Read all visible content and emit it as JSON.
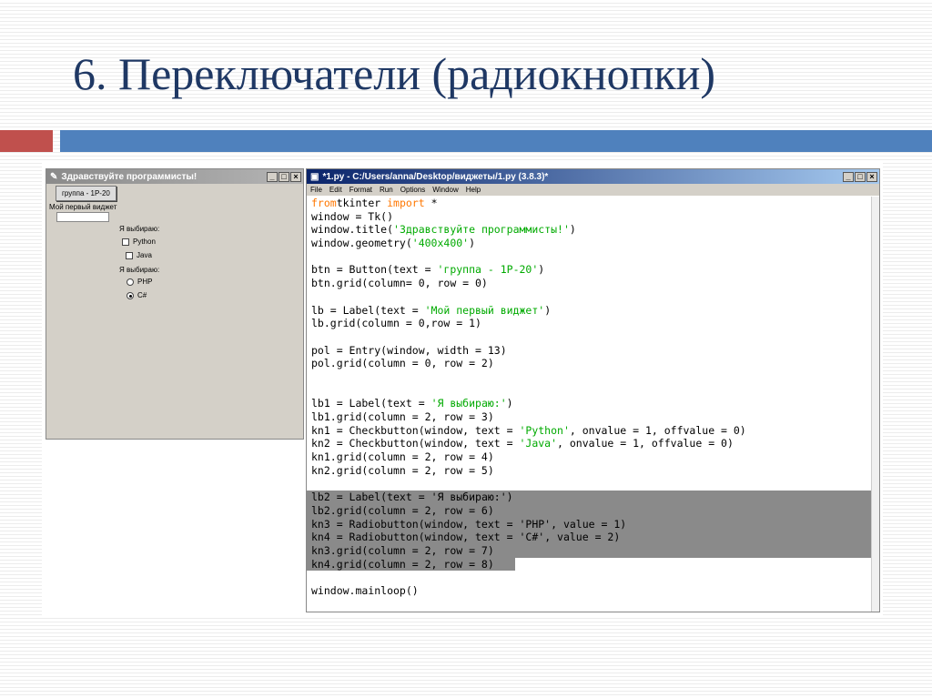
{
  "slide": {
    "title": "6. Переключатели (радиокнопки)"
  },
  "tk_window": {
    "title": "Здравствуйте программисты!",
    "button": "группа - 1Р-20",
    "label": "Мой первый виджет",
    "entry_value": "",
    "label1": "Я выбираю:",
    "check1": "Python",
    "check2": "Java",
    "label2": "Я выбираю:",
    "radio1": "PHP",
    "radio2": "C#",
    "selected_radio": "C#"
  },
  "idle": {
    "title": "*1.py - C:/Users/anna/Desktop/виджеты/1.py (3.8.3)*",
    "menu": [
      "File",
      "Edit",
      "Format",
      "Run",
      "Options",
      "Window",
      "Help"
    ],
    "code": [
      {
        "s": [
          [
            "kw",
            "from"
          ],
          [
            "",
            "tkinter "
          ],
          [
            "kw",
            "import"
          ],
          [
            "",
            " *"
          ]
        ]
      },
      {
        "s": [
          [
            "",
            "window = Tk()"
          ]
        ]
      },
      {
        "s": [
          [
            "",
            "window.title("
          ],
          [
            "str",
            "'Здравствуйте программисты!'"
          ],
          [
            "",
            ")"
          ]
        ]
      },
      {
        "s": [
          [
            "",
            "window.geometry("
          ],
          [
            "str",
            "'400x400'"
          ],
          [
            "",
            ")"
          ]
        ]
      },
      {
        "s": []
      },
      {
        "s": [
          [
            "",
            "btn = Button(text = "
          ],
          [
            "str",
            "'группа - 1Р-20'"
          ],
          [
            "",
            ")"
          ]
        ]
      },
      {
        "s": [
          [
            "",
            "btn.grid(column= 0, row = 0)"
          ]
        ]
      },
      {
        "s": []
      },
      {
        "s": [
          [
            "",
            "lb = Label(text = "
          ],
          [
            "str",
            "'Мой первый виджет'"
          ],
          [
            "",
            ")"
          ]
        ]
      },
      {
        "s": [
          [
            "",
            "lb.grid(column = 0,row = 1)"
          ]
        ]
      },
      {
        "s": []
      },
      {
        "s": [
          [
            "",
            "pol = Entry(window, width = 13)"
          ]
        ]
      },
      {
        "s": [
          [
            "",
            "pol.grid(column = 0, row = 2)"
          ]
        ]
      },
      {
        "s": []
      },
      {
        "s": []
      },
      {
        "s": [
          [
            "",
            "lb1 = Label(text = "
          ],
          [
            "str",
            "'Я выбираю:'"
          ],
          [
            "",
            ")"
          ]
        ]
      },
      {
        "s": [
          [
            "",
            "lb1.grid(column = 2, row = 3)"
          ]
        ]
      },
      {
        "s": [
          [
            "",
            "kn1 = Checkbutton(window, text = "
          ],
          [
            "str",
            "'Python'"
          ],
          [
            "",
            ", onvalue = 1, offvalue = 0)"
          ]
        ]
      },
      {
        "s": [
          [
            "",
            "kn2 = Checkbutton(window, text = "
          ],
          [
            "str",
            "'Java'"
          ],
          [
            "",
            ", onvalue = 1, offvalue = 0)"
          ]
        ]
      },
      {
        "s": [
          [
            "",
            "kn1.grid(column = 2, row = 4)"
          ]
        ]
      },
      {
        "s": [
          [
            "",
            "kn2.grid(column = 2, row = 5)"
          ]
        ]
      },
      {
        "s": []
      },
      {
        "sel": "full",
        "s": [
          [
            "",
            "lb2 = Label(text = "
          ],
          [
            "str",
            "'Я выбираю:'"
          ],
          [
            "",
            ")"
          ]
        ]
      },
      {
        "sel": "full",
        "s": [
          [
            "",
            "lb2.grid(column = 2, row = 6)"
          ]
        ]
      },
      {
        "sel": "full",
        "s": [
          [
            "",
            "kn3 = Radiobutton(window, text = "
          ],
          [
            "str",
            "'PHP'"
          ],
          [
            "",
            ", value = 1)"
          ]
        ]
      },
      {
        "sel": "full",
        "s": [
          [
            "",
            "kn4 = Radiobutton(window, text = "
          ],
          [
            "str",
            "'C#'"
          ],
          [
            "",
            ", value = 2)"
          ]
        ]
      },
      {
        "sel": "full",
        "s": [
          [
            "",
            "kn3.grid(column = 2, row = 7)"
          ]
        ]
      },
      {
        "sel": "part",
        "s": [
          [
            "",
            "kn4.grid(column = 2, row = 8)"
          ]
        ]
      },
      {
        "s": []
      },
      {
        "s": [
          [
            "",
            "window.mainloop()"
          ]
        ]
      }
    ]
  },
  "colors": {
    "title": "#1f3864",
    "accent_red": "#c0504d",
    "accent_blue": "#4f81bd",
    "keyword": "#ff7700",
    "string": "#00aa00",
    "selection": "#8a8a8a"
  }
}
